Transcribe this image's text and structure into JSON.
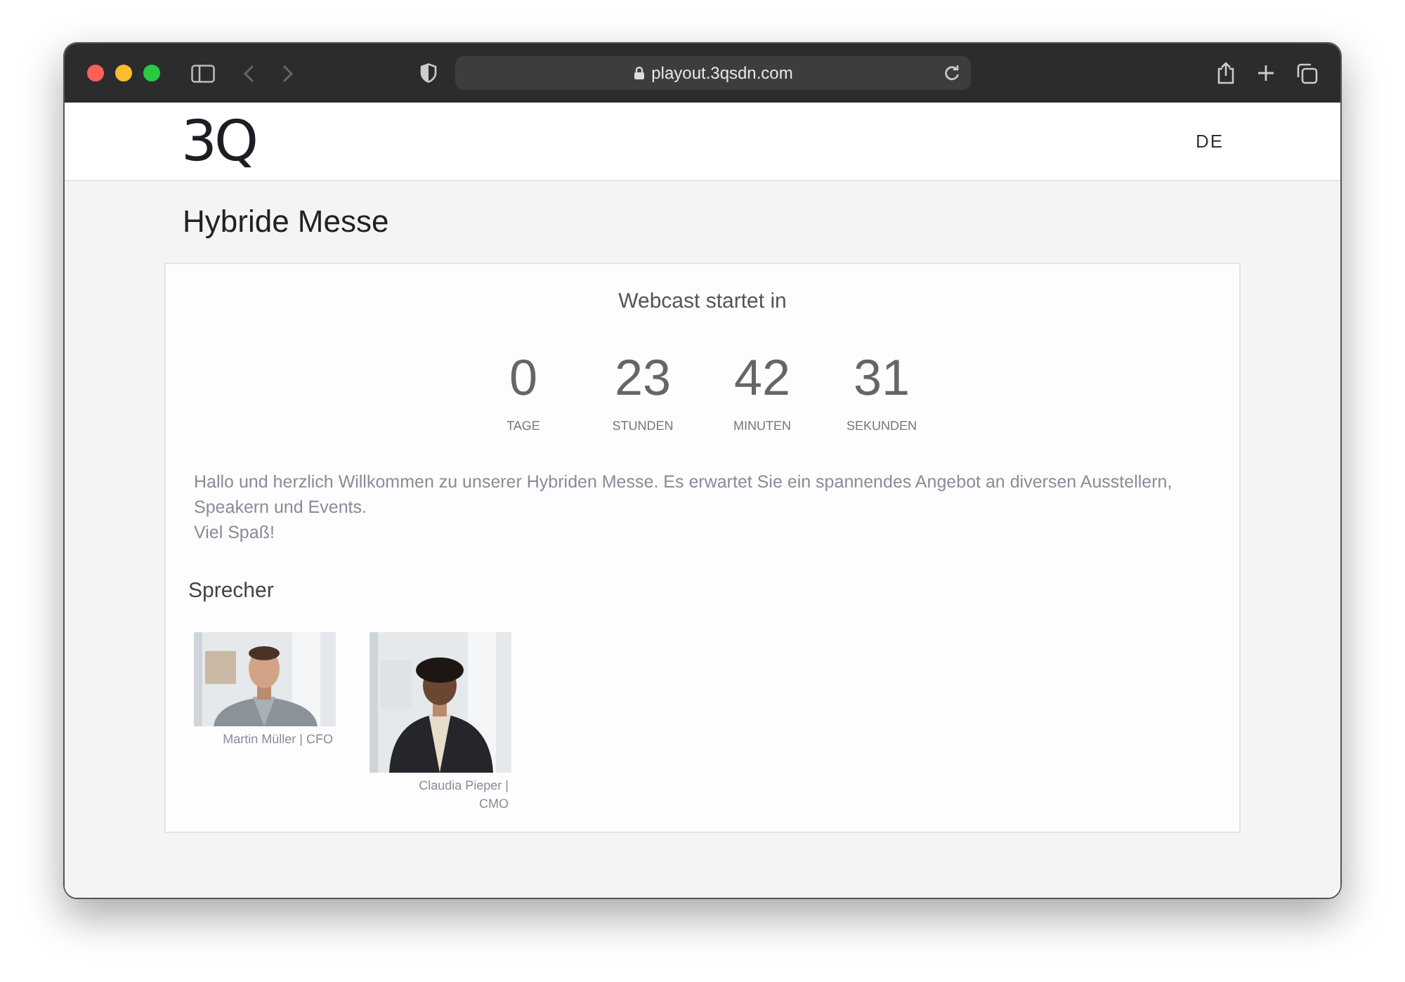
{
  "browser": {
    "url": "playout.3qsdn.com"
  },
  "header": {
    "logo": "3Q",
    "language": "DE"
  },
  "page_title": "Hybride Messe",
  "countdown": {
    "heading": "Webcast startet in",
    "units": [
      {
        "value": "0",
        "label": "TAGE"
      },
      {
        "value": "23",
        "label": "STUNDEN"
      },
      {
        "value": "42",
        "label": "MINUTEN"
      },
      {
        "value": "31",
        "label": "SEKUNDEN"
      }
    ]
  },
  "welcome_text": [
    "Hallo und herzlich Willkommen zu unserer Hybriden Messe. Es erwartet Sie ein spannendes Angebot an diversen Ausstellern, Speakern und Events.",
    "Viel Spaß!"
  ],
  "speakers": {
    "heading": "Sprecher",
    "items": [
      {
        "caption": "Martin Müller | CFO",
        "kind": "picture"
      },
      {
        "caption": "Claudia Pieper | CMO",
        "kind": "picture"
      }
    ]
  }
}
